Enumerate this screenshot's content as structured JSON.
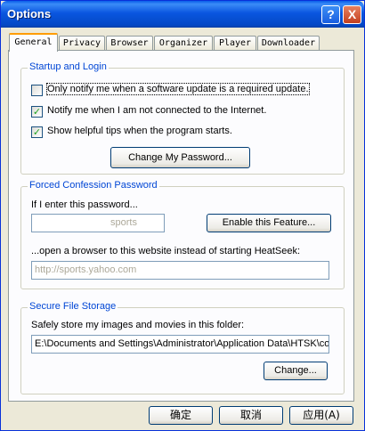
{
  "window": {
    "title": "Options",
    "help_label": "?",
    "close_label": "X"
  },
  "tabs": [
    {
      "label": "General",
      "active": true
    },
    {
      "label": "Privacy",
      "active": false
    },
    {
      "label": "Browser",
      "active": false
    },
    {
      "label": "Organizer",
      "active": false
    },
    {
      "label": "Player",
      "active": false
    },
    {
      "label": "Downloader",
      "active": false
    }
  ],
  "startup": {
    "title": "Startup and Login",
    "options": [
      {
        "label": "Only notify me when a software update is a required update.",
        "checked": false
      },
      {
        "label": "Notify me when I am not connected to the Internet.",
        "checked": true
      },
      {
        "label": "Show helpful tips when the program starts.",
        "checked": true
      }
    ],
    "change_password_label": "Change My Password..."
  },
  "forced": {
    "title": "Forced Confession Password",
    "prompt": "If I enter this password...",
    "password_value": "sports",
    "enable_label": "Enable this Feature...",
    "browser_prompt": "...open a browser to this website instead of starting HeatSeek:",
    "url_value": "http://sports.yahoo.com"
  },
  "storage": {
    "title": "Secure File Storage",
    "prompt": "Safely store my images and movies in this folder:",
    "folder_value": "E:\\Documents and Settings\\Administrator\\Application Data\\HTSK\\con",
    "change_label": "Change..."
  },
  "buttons": {
    "ok": "确定",
    "cancel": "取消",
    "apply": "应用(A)"
  }
}
